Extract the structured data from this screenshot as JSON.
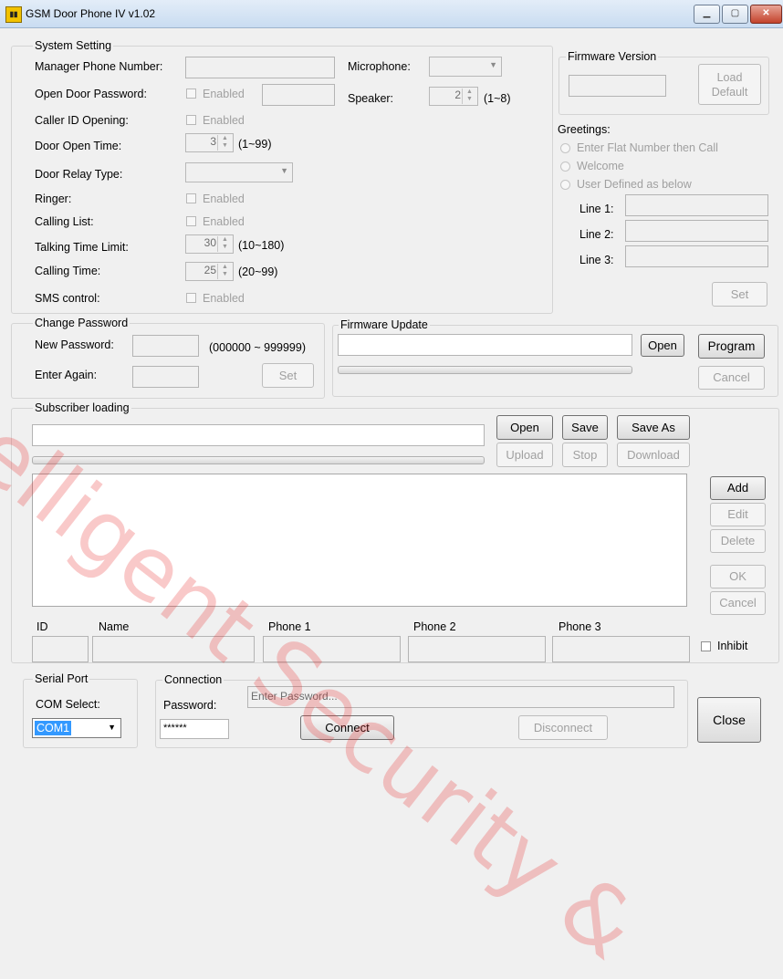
{
  "window": {
    "title": "GSM Door Phone IV v1.02",
    "icon": "gsm-signal-icon"
  },
  "system_setting": {
    "group_label": "System Setting",
    "manager_phone_label": "Manager Phone Number:",
    "open_door_password_label": "Open Door Password:",
    "caller_id_label": "Caller ID Opening:",
    "door_open_time_label": "Door Open Time:",
    "door_open_time_value": "3",
    "door_open_time_range": "(1~99)",
    "door_relay_label": "Door Relay Type:",
    "ringer_label": "Ringer:",
    "calling_list_label": "Calling List:",
    "talking_time_label": "Talking Time Limit:",
    "talking_time_value": "30",
    "talking_time_range": "(10~180)",
    "calling_time_label": "Calling Time:",
    "calling_time_value": "25",
    "calling_time_range": "(20~99)",
    "sms_label": "SMS control:",
    "enabled_text": "Enabled",
    "microphone_label": "Microphone:",
    "speaker_label": "Speaker:",
    "speaker_value": "2",
    "speaker_range": "(1~8)"
  },
  "firmware_version": {
    "group_label": "Firmware Version",
    "load_default_line1": "Load",
    "load_default_line2": "Default"
  },
  "greetings": {
    "label": "Greetings:",
    "options": [
      "Enter Flat Number then Call",
      "Welcome",
      "User Defined as below"
    ],
    "line1_label": "Line 1:",
    "line2_label": "Line 2:",
    "line3_label": "Line 3:",
    "set_label": "Set"
  },
  "change_password": {
    "group_label": "Change Password",
    "new_label": "New Password:",
    "range": "(000000 ~ 999999)",
    "again_label": "Enter Again:",
    "set_label": "Set"
  },
  "firmware_update": {
    "group_label": "Firmware Update",
    "open_label": "Open",
    "program_label": "Program",
    "cancel_label": "Cancel"
  },
  "subscriber": {
    "group_label": "Subscriber loading",
    "open_label": "Open",
    "save_label": "Save",
    "save_as_label": "Save As",
    "upload_label": "Upload",
    "stop_label": "Stop",
    "download_label": "Download",
    "add_label": "Add",
    "edit_label": "Edit",
    "delete_label": "Delete",
    "ok_label": "OK",
    "cancel_label": "Cancel",
    "columns": [
      "ID",
      "Name",
      "Phone 1",
      "Phone 2",
      "Phone 3"
    ],
    "inhibit_label": "Inhibit"
  },
  "serial_port": {
    "group_label": "Serial Port",
    "com_label": "COM Select:",
    "com_value": "COM1"
  },
  "connection": {
    "group_label": "Connection",
    "password_label": "Password:",
    "password_value": "******",
    "status_placeholder": "Enter Password...",
    "connect_label": "Connect",
    "disconnect_label": "Disconnect"
  },
  "close_label": "Close",
  "watermark_text": "Intelligent Security &",
  "colors": {
    "disabled_text": "#a0a0a0",
    "selection": "#3399ff",
    "watermark": "#e62828"
  }
}
